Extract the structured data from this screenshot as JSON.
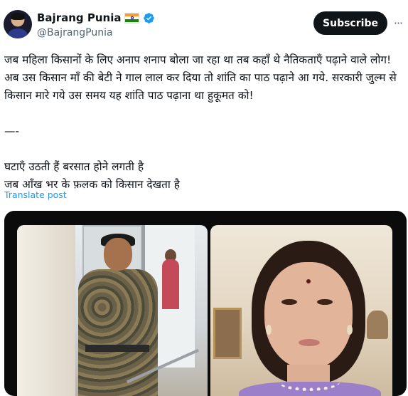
{
  "author": {
    "display_name": "Bajrang Punia",
    "handle": "@BajrangPunia",
    "flag_icon": "indian-flag-icon",
    "verified_icon": "verified-badge-icon",
    "verified_color": "#1d9bf0"
  },
  "actions": {
    "subscribe_label": "Subscribe",
    "more_label": "···"
  },
  "post": {
    "paragraph": "जब महिला किसानों के लिए अनाप शनाप बोला जा रहा था तब कहाँ थे नैतिकताएँ पढ़ाने वाले लोग! अब उस किसान माँ की बेटी ने गाल लाल कर दिया तो शांति का पाठ पढ़ाने आ गये. सरकारी जुल्म से किसान मारे गये उस समय यह शांति पाठ पढ़ाना था हुकूमत को!",
    "separator": "—-",
    "verse_line_1": "घटाएँ उठती हैं बरसात होने लगती है",
    "verse_line_2": "जब आँख भर के फ़लक को किसान देखता है"
  },
  "translate_label": "Translate post",
  "colors": {
    "text": "#0f1419",
    "secondary": "#536471",
    "link": "#1d9bf0",
    "button_bg": "#0f1419"
  }
}
